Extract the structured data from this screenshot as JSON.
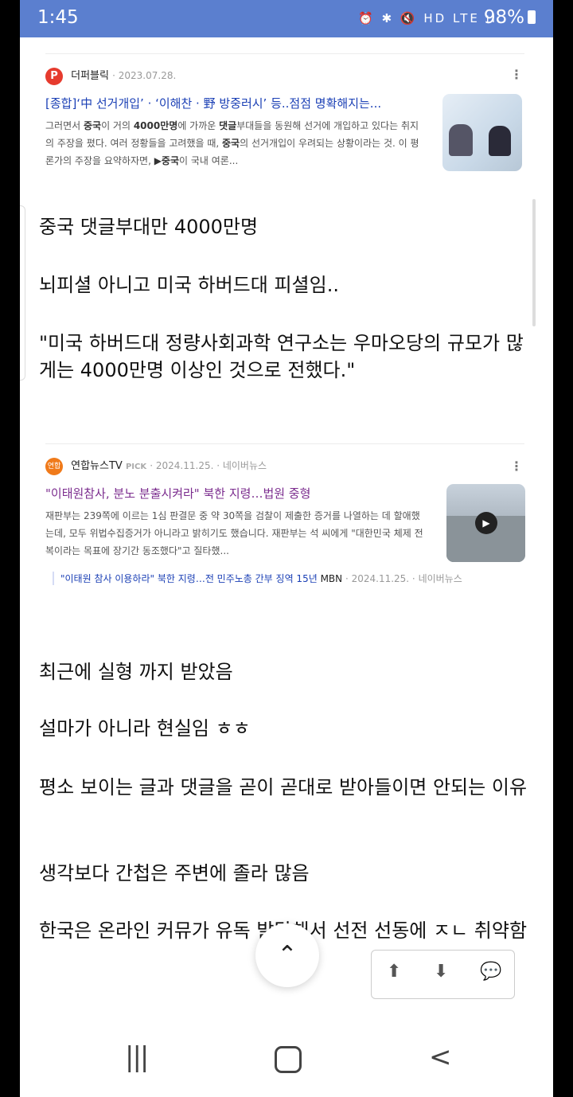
{
  "status": {
    "time": "1:45",
    "icons": "⏰ ✱ 🔇 HD LTE ıl",
    "battery": "98%"
  },
  "card1": {
    "outlet": "더퍼블릭",
    "logo": "P",
    "date": "· 2023.07.28.",
    "menu": "⋮",
    "headline": "[종합]‘中 선거개입’ · ‘이해찬 · 野 방중러시’ 등..점점 명확해지는...",
    "snippet_pre1": "그러면서 ",
    "snippet_b1": "중국",
    "snippet_mid1": "이 거의 ",
    "snippet_b2": "4000만명",
    "snippet_mid2": "에 가까운 ",
    "snippet_b3": "댓글",
    "snippet_mid3": "부대들을 동원해 선거에 개입하고 있다는 취지의 주장을 폈다. 여러 정황들을 고려했을 때, ",
    "snippet_b4": "중국",
    "snippet_mid4": "의 선거개입이 우려되는 상황이라는 것. 이 평론가의 주장을 요약하자면, ",
    "snippet_b5": "▶중국",
    "snippet_end": "이 국내 여론..."
  },
  "para1": "중국 댓글부대만 4000만명",
  "para2": "뇌피셜 아니고 미국 하버드대 피셜임..",
  "para3": "\"미국 하버드대 정량사회과학 연구소는 우마오당의 규모가 많게는 4000만명 이상인 것으로 전했다.\"",
  "card2": {
    "outlet": "연합뉴스TV",
    "logo": "연합",
    "pick": "PICK",
    "date": "· 2024.11.25. · 네이버뉴스",
    "menu": "⋮",
    "headline": "\"이태원참사, 분노 분출시켜라\" 북한 지령…법원 중형",
    "snippet": "재판부는 239쪽에 이르는 1심 판결문 중 약 30쪽을 검찰이 제출한 증거를 나열하는 데 할애했는데, 모두 위법수집증거가 아니라고 밝히기도 했습니다. 재판부는 석 씨에게 \"대한민국 체제 전복이라는 목표에 장기간 동조했다\"고 질타했...",
    "play": "▶",
    "related_title": "\"이태원 참사 이용하라\" 북한 지령…전 민주노총 간부 징역 15년",
    "related_outlet": "MBN",
    "related_meta": "· 2024.11.25. · 네이버뉴스"
  },
  "para4": "최근에 실형 까지 받았음",
  "para5": "설마가 아니라 현실임 ㅎㅎ",
  "para6": "평소 보이는 글과 댓글을 곧이 곧대로 받아들이면 안되는 이유",
  "para7": "생각보다 간첩은 주변에 졸라 많음",
  "para8": "한국은 온라인 커뮤가 유독 발달해서 선전 선동에 ㅈㄴ 취약함",
  "controls": {
    "top": "⌃",
    "up": "⬆",
    "down": "⬇",
    "comment": "💬"
  },
  "nav": {
    "recent": "|||",
    "back": "<"
  }
}
